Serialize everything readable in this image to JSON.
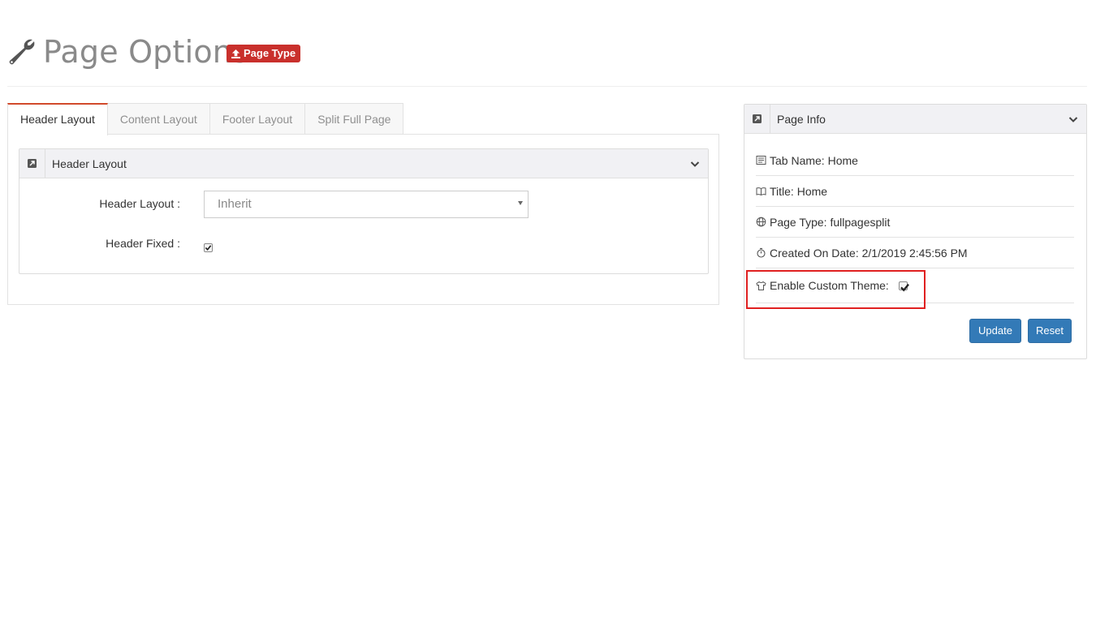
{
  "header": {
    "title": "Page Options",
    "badge_label": "Page Type",
    "icon": "wrench-icon"
  },
  "tabs": [
    {
      "label": "Header Layout",
      "active": true
    },
    {
      "label": "Content Layout",
      "active": false
    },
    {
      "label": "Footer Layout",
      "active": false
    },
    {
      "label": "Split Full Page",
      "active": false
    }
  ],
  "header_layout_panel": {
    "title": "Header Layout",
    "fields": {
      "layout_label": "Header Layout :",
      "layout_value": "Inherit",
      "fixed_label": "Header Fixed :",
      "fixed_checked": true
    }
  },
  "page_info": {
    "title": "Page Info",
    "rows": [
      {
        "icon": "newspaper-icon",
        "text": "Tab Name: Home"
      },
      {
        "icon": "book-icon",
        "text": "Title: Home"
      },
      {
        "icon": "globe-icon",
        "text": "Page Type: fullpagesplit"
      },
      {
        "icon": "stopwatch-icon",
        "text": "Created On Date: 2/1/2019 2:45:56 PM"
      }
    ],
    "custom_theme_label": "Enable Custom Theme:",
    "custom_theme_checked": true,
    "update_label": "Update",
    "reset_label": "Reset"
  },
  "colors": {
    "badge": "#c9302c",
    "tab_accent": "#d14a2b",
    "button": "#337ab7",
    "highlight": "#e02020"
  }
}
